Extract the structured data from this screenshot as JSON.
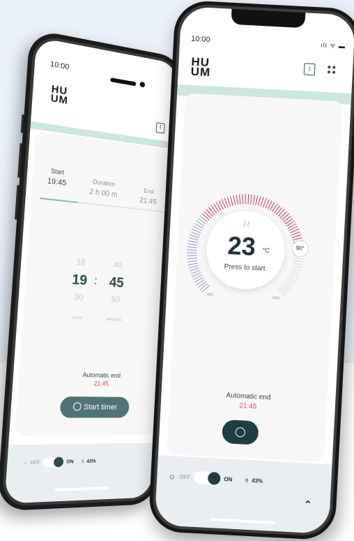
{
  "back_phone": {
    "status_time": "10:00",
    "logo_top": "HU",
    "logo_bottom": "UM",
    "calendar_day": "1",
    "tabs": [
      {
        "label": "Start",
        "value": "19:45"
      },
      {
        "label": "Duration",
        "value": "2 h 00 m"
      },
      {
        "label": "End",
        "value": "21:45"
      }
    ],
    "hour_wheel": {
      "prev": "18",
      "current": "19",
      "next": "20",
      "unit": "HOUR"
    },
    "minute_wheel": {
      "prev": "40",
      "current": "45",
      "next": "50",
      "unit": "MINUTES"
    },
    "colon": ":",
    "automatic_end_label": "Automatic end",
    "automatic_end_time": "21:45",
    "start_button": "Start timer",
    "light_off": "OFF",
    "light_on": "ON",
    "humidity": "43%"
  },
  "front_phone": {
    "status_time": "10:00",
    "status_icons": "ıll ᯤ ▬",
    "logo_top": "HU",
    "logo_bottom": "UM",
    "calendar_day": "1",
    "temperature": "23",
    "temperature_unit": "°C",
    "press_label": "Press to start",
    "target_badge": "90°",
    "min_label": "MIN",
    "max_label": "MAX",
    "automatic_end_label": "Automatic end",
    "automatic_end_time": "21:45",
    "light_off": "OFF",
    "light_on": "ON",
    "humidity": "43%",
    "steam_icon": "≀≀"
  },
  "colors": {
    "accent_teal": "#1f3d42",
    "mint": "#cfe6e0",
    "alert_red": "#d34b5a",
    "dial_hot": "#c9374c",
    "dial_cold": "#8f97c9"
  }
}
